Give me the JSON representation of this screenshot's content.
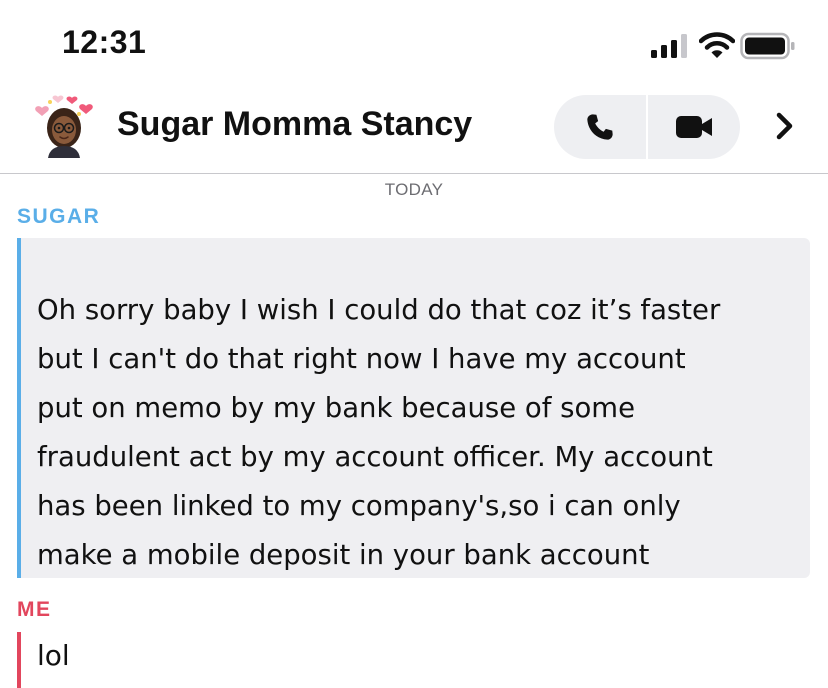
{
  "status_bar": {
    "time": "12:31",
    "icons": [
      "cellular-signal-icon",
      "wifi-icon",
      "battery-icon"
    ]
  },
  "header": {
    "contact_name": "Sugar Momma Stancy",
    "avatar_icon": "bitmoji-avatar-with-hearts",
    "actions": [
      "phone-icon",
      "video-camera-icon",
      "chevron-right-icon"
    ]
  },
  "chat": {
    "date_label": "TODAY",
    "messages": [
      {
        "sender": "SUGAR",
        "color": "#5aaee8",
        "text": "Oh sorry baby I wish I could do that coz it’s faster\nbut I can't do that right now I have my account\nput on memo by my bank because of some\nfraudulent act by my account officer. My account\nhas been linked to my company's,so i can only\nmake a mobile deposit in your bank account"
      },
      {
        "sender": "ME",
        "color": "#e2465d",
        "text": "lol"
      }
    ]
  },
  "colors": {
    "sugar_accent": "#5aaee8",
    "me_accent": "#e2465d",
    "bubble_bg": "#efeff2",
    "pill_bg": "#eeeff2"
  }
}
